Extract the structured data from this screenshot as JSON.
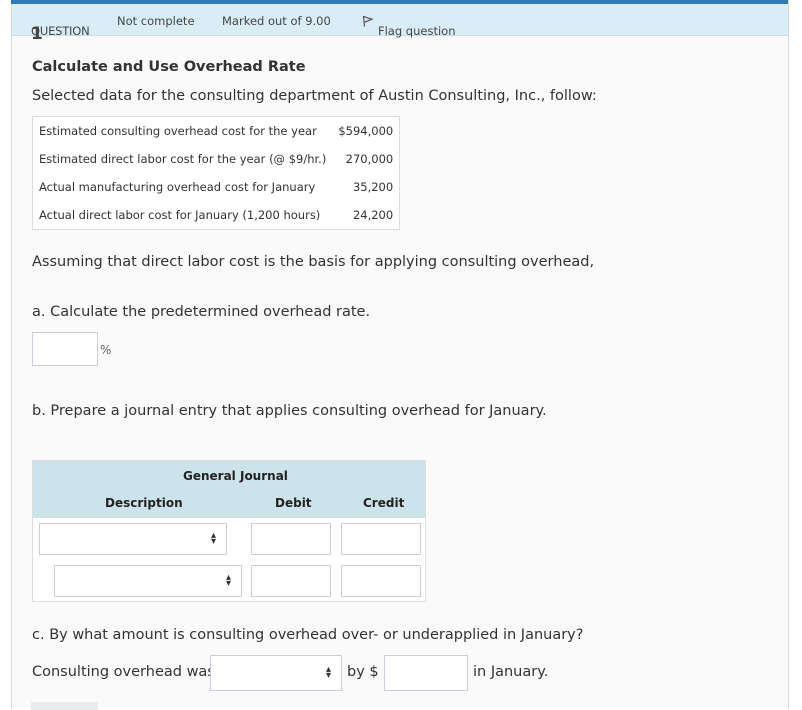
{
  "header": {
    "question_label": "QUESTION",
    "question_number": "1",
    "state": "Not complete",
    "marks": "Marked out of 9.00",
    "flag_label": "Flag question",
    "flag_icon": "flag-icon"
  },
  "question": {
    "title": "Calculate and Use Overhead Rate",
    "intro": "Selected data for the consulting department of Austin Consulting, Inc., follow:",
    "data_rows": [
      {
        "label": "Estimated consulting overhead cost for the year",
        "value": "$594,000"
      },
      {
        "label": "Estimated direct labor cost for the year (@ $9/hr.)",
        "value": "270,000"
      },
      {
        "label": "Actual manufacturing overhead cost for January",
        "value": "35,200"
      },
      {
        "label": "Actual direct labor cost for January (1,200 hours)",
        "value": "24,200"
      }
    ],
    "assumption": "Assuming that direct labor cost is the basis for applying consulting overhead,",
    "part_a": {
      "prompt": "a. Calculate the predetermined overhead rate.",
      "rate_value": "",
      "unit": "%"
    },
    "part_b": {
      "prompt": "b. Prepare a journal entry that applies consulting overhead for January.",
      "journal": {
        "title": "General Journal",
        "col_description": "Description",
        "col_debit": "Debit",
        "col_credit": "Credit",
        "rows": [
          {
            "description": "",
            "debit": "",
            "credit": ""
          },
          {
            "description": "",
            "debit": "",
            "credit": ""
          }
        ]
      }
    },
    "part_c": {
      "prompt": "c. By what amount is consulting overhead over- or underapplied in January?",
      "prefix": "Consulting overhead was",
      "selection": "",
      "by_label": "by $",
      "amount": "",
      "suffix": "in January."
    }
  },
  "colors": {
    "accent": "#2f7ab9",
    "header_bg": "#d9edf7",
    "journal_header_bg": "#cde3ec"
  }
}
